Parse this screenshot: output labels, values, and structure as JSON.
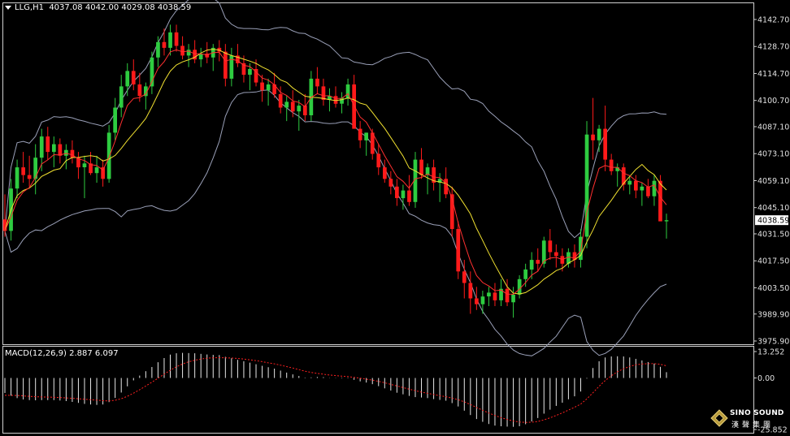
{
  "header": {
    "symbol": "LLG,H1",
    "ohlc": "4037.08 4042.00 4029.08 4038.59"
  },
  "macd_header": "MACD(12,26,9) 2.887 6.097",
  "logo": {
    "name": "SINO SOUND",
    "cn": "漢聲集團"
  },
  "chart_data": {
    "type": "candlestick",
    "price_axis": {
      "ticks": [
        "4142.70",
        "4128.70",
        "4114.70",
        "4100.70",
        "4087.10",
        "4073.10",
        "4059.10",
        "4045.10",
        "4031.50",
        "4017.50",
        "4003.50",
        "3989.90",
        "3975.90"
      ],
      "ylim": [
        3975.9,
        4142.7
      ]
    },
    "last_price": "4038.59",
    "macd_axis": {
      "ticks": [
        "13.252",
        "0.00",
        "-25.852"
      ],
      "ylim": [
        -25.852,
        13.252
      ]
    },
    "candles": [
      [
        4039,
        4052,
        4030,
        4033
      ],
      [
        4033,
        4060,
        4028,
        4055
      ],
      [
        4055,
        4070,
        4050,
        4066
      ],
      [
        4066,
        4074,
        4058,
        4062
      ],
      [
        4062,
        4072,
        4056,
        4060
      ],
      [
        4060,
        4078,
        4052,
        4071
      ],
      [
        4071,
        4086,
        4064,
        4082
      ],
      [
        4082,
        4087,
        4070,
        4074
      ],
      [
        4074,
        4082,
        4066,
        4078
      ],
      [
        4078,
        4081,
        4068,
        4072
      ],
      [
        4072,
        4078,
        4065,
        4075
      ],
      [
        4075,
        4080,
        4068,
        4071
      ],
      [
        4071,
        4074,
        4060,
        4066
      ],
      [
        4066,
        4072,
        4050,
        4068
      ],
      [
        4068,
        4074,
        4062,
        4063
      ],
      [
        4063,
        4072,
        4058,
        4066
      ],
      [
        4066,
        4070,
        4056,
        4060
      ],
      [
        4060,
        4088,
        4058,
        4084
      ],
      [
        4084,
        4102,
        4080,
        4097
      ],
      [
        4097,
        4114,
        4092,
        4108
      ],
      [
        4108,
        4120,
        4103,
        4116
      ],
      [
        4116,
        4122,
        4106,
        4109
      ],
      [
        4109,
        4115,
        4100,
        4103
      ],
      [
        4103,
        4110,
        4096,
        4108
      ],
      [
        4108,
        4126,
        4104,
        4123
      ],
      [
        4123,
        4134,
        4118,
        4131
      ],
      [
        4131,
        4138,
        4124,
        4128
      ],
      [
        4128,
        4140,
        4124,
        4136
      ],
      [
        4136,
        4140,
        4126,
        4129
      ],
      [
        4129,
        4134,
        4122,
        4124
      ],
      [
        4124,
        4130,
        4118,
        4127
      ],
      [
        4127,
        4132,
        4120,
        4122
      ],
      [
        4122,
        4128,
        4118,
        4125
      ],
      [
        4125,
        4131,
        4120,
        4123
      ],
      [
        4123,
        4130,
        4116,
        4128
      ],
      [
        4128,
        4132,
        4121,
        4126
      ],
      [
        4126,
        4130,
        4108,
        4112
      ],
      [
        4112,
        4128,
        4108,
        4124
      ],
      [
        4124,
        4130,
        4118,
        4120
      ],
      [
        4120,
        4124,
        4110,
        4114
      ],
      [
        4114,
        4120,
        4106,
        4117
      ],
      [
        4117,
        4122,
        4108,
        4110
      ],
      [
        4110,
        4114,
        4100,
        4106
      ],
      [
        4106,
        4112,
        4098,
        4109
      ],
      [
        4109,
        4115,
        4102,
        4104
      ],
      [
        4104,
        4108,
        4094,
        4097
      ],
      [
        4097,
        4103,
        4090,
        4100
      ],
      [
        4100,
        4106,
        4092,
        4095
      ],
      [
        4095,
        4101,
        4085,
        4098
      ],
      [
        4098,
        4104,
        4090,
        4093
      ],
      [
        4093,
        4116,
        4090,
        4112
      ],
      [
        4112,
        4118,
        4104,
        4108
      ],
      [
        4108,
        4112,
        4098,
        4101
      ],
      [
        4101,
        4107,
        4095,
        4103
      ],
      [
        4103,
        4108,
        4097,
        4099
      ],
      [
        4099,
        4105,
        4094,
        4102
      ],
      [
        4102,
        4112,
        4098,
        4109
      ],
      [
        4109,
        4114,
        4090,
        4086
      ],
      [
        4086,
        4090,
        4076,
        4080
      ],
      [
        4080,
        4084,
        4072,
        4084
      ],
      [
        4084,
        4086,
        4070,
        4073
      ],
      [
        4073,
        4078,
        4062,
        4066
      ],
      [
        4066,
        4070,
        4058,
        4060
      ],
      [
        4060,
        4064,
        4052,
        4056
      ],
      [
        4056,
        4060,
        4046,
        4050
      ],
      [
        4050,
        4057,
        4044,
        4054
      ],
      [
        4054,
        4062,
        4046,
        4048
      ],
      [
        4048,
        4074,
        4045,
        4070
      ],
      [
        4070,
        4076,
        4060,
        4062
      ],
      [
        4062,
        4068,
        4052,
        4066
      ],
      [
        4066,
        4070,
        4054,
        4058
      ],
      [
        4058,
        4063,
        4048,
        4060
      ],
      [
        4060,
        4066,
        4050,
        4052
      ],
      [
        4052,
        4056,
        4030,
        4034
      ],
      [
        4034,
        4038,
        4008,
        4012
      ],
      [
        4012,
        4018,
        3998,
        4006
      ],
      [
        4006,
        4012,
        3990,
        3998
      ],
      [
        3998,
        4004,
        3992,
        3995
      ],
      [
        3995,
        4002,
        3990,
        3999
      ],
      [
        3999,
        4004,
        3994,
        4001
      ],
      [
        4001,
        4006,
        3994,
        3997
      ],
      [
        3997,
        4008,
        3994,
        4003
      ],
      [
        4003,
        4008,
        3994,
        3996
      ],
      [
        3996,
        4004,
        3988,
        4000
      ],
      [
        4000,
        4010,
        3998,
        4008
      ],
      [
        4008,
        4016,
        4004,
        4013
      ],
      [
        4013,
        4022,
        4008,
        4018
      ],
      [
        4018,
        4024,
        4012,
        4016
      ],
      [
        4016,
        4030,
        4014,
        4028
      ],
      [
        4028,
        4034,
        4018,
        4022
      ],
      [
        4022,
        4026,
        4014,
        4020
      ],
      [
        4020,
        4024,
        4012,
        4016
      ],
      [
        4016,
        4024,
        4014,
        4022
      ],
      [
        4022,
        4026,
        4014,
        4018
      ],
      [
        4018,
        4034,
        4014,
        4030
      ],
      [
        4030,
        4090,
        4024,
        4083
      ],
      [
        4083,
        4102,
        4070,
        4080
      ],
      [
        4080,
        4088,
        4074,
        4086
      ],
      [
        4086,
        4098,
        4064,
        4070
      ],
      [
        4070,
        4073,
        4062,
        4064
      ],
      [
        4064,
        4068,
        4056,
        4066
      ],
      [
        4066,
        4068,
        4054,
        4057
      ],
      [
        4057,
        4062,
        4052,
        4059
      ],
      [
        4059,
        4062,
        4050,
        4054
      ],
      [
        4054,
        4058,
        4046,
        4056
      ],
      [
        4056,
        4060,
        4050,
        4051
      ],
      [
        4051,
        4062,
        4046,
        4059
      ],
      [
        4059,
        4062,
        4040,
        4038
      ],
      [
        4038,
        4042,
        4029,
        4038.59
      ]
    ],
    "macd_histogram": [
      -7.5,
      -8.9,
      -10.1,
      -10.8,
      -11.1,
      -11.2,
      -11.1,
      -11.1,
      -11.1,
      -11.3,
      -11.6,
      -12.0,
      -12.5,
      -13.0,
      -13.3,
      -13.5,
      -13.3,
      -12.1,
      -10.0,
      -7.3,
      -4.2,
      -1.2,
      1.2,
      3.4,
      5.5,
      7.9,
      10.0,
      11.7,
      12.4,
      12.6,
      12.5,
      12.4,
      12.1,
      11.8,
      11.6,
      11.5,
      10.6,
      9.9,
      9.1,
      8.4,
      7.7,
      6.9,
      6.1,
      5.4,
      4.7,
      3.7,
      2.7,
      1.8,
      1.0,
      0.2,
      0.3,
      0.5,
      0.4,
      0.1,
      -0.1,
      -0.2,
      -0.2,
      -0.9,
      -1.7,
      -2.3,
      -3.1,
      -4.1,
      -5.2,
      -6.3,
      -7.4,
      -8.2,
      -9.0,
      -9.6,
      -9.8,
      -10.1,
      -10.6,
      -11.0,
      -11.4,
      -12.6,
      -14.3,
      -16.4,
      -18.6,
      -20.6,
      -22.0,
      -23.1,
      -23.9,
      -24.2,
      -24.4,
      -24.5,
      -24.2,
      -23.2,
      -21.8,
      -20.1,
      -17.9,
      -15.9,
      -14.0,
      -12.4,
      -10.7,
      -9.2,
      -6.8,
      -0.3,
      5.0,
      8.4,
      10.3,
      10.8,
      10.9,
      10.8,
      10.3,
      9.6,
      8.8,
      8.0,
      7.2,
      5.6,
      2.9
    ],
    "macd_signal": [
      -8.7,
      -8.7,
      -8.8,
      -9.0,
      -9.2,
      -9.4,
      -9.5,
      -9.6,
      -9.7,
      -9.8,
      -10.0,
      -10.2,
      -10.4,
      -10.7,
      -10.9,
      -11.1,
      -11.4,
      -11.5,
      -11.2,
      -10.4,
      -9.2,
      -7.6,
      -5.9,
      -4.0,
      -2.1,
      -0.1,
      1.9,
      3.9,
      5.6,
      7.0,
      8.1,
      8.9,
      9.5,
      9.9,
      10.1,
      10.2,
      10.1,
      10.0,
      9.8,
      9.5,
      9.1,
      8.7,
      8.2,
      7.6,
      7.1,
      6.4,
      5.7,
      5.0,
      4.2,
      3.4,
      2.8,
      2.3,
      1.9,
      1.5,
      1.2,
      0.9,
      0.7,
      0.3,
      -0.1,
      -0.6,
      -1.1,
      -1.7,
      -2.4,
      -3.2,
      -4.0,
      -4.8,
      -5.6,
      -6.4,
      -7.1,
      -7.7,
      -8.3,
      -8.9,
      -9.4,
      -10.1,
      -10.9,
      -12.0,
      -13.3,
      -14.8,
      -16.2,
      -17.6,
      -18.8,
      -19.9,
      -20.8,
      -21.6,
      -22.1,
      -22.3,
      -22.2,
      -21.8,
      -21.0,
      -20.0,
      -18.8,
      -17.5,
      -16.1,
      -14.7,
      -13.1,
      -10.5,
      -7.4,
      -4.2,
      -1.3,
      1.1,
      3.1,
      4.6,
      5.8,
      6.6,
      7.0,
      7.2,
      7.2,
      6.9,
      6.1
    ]
  }
}
